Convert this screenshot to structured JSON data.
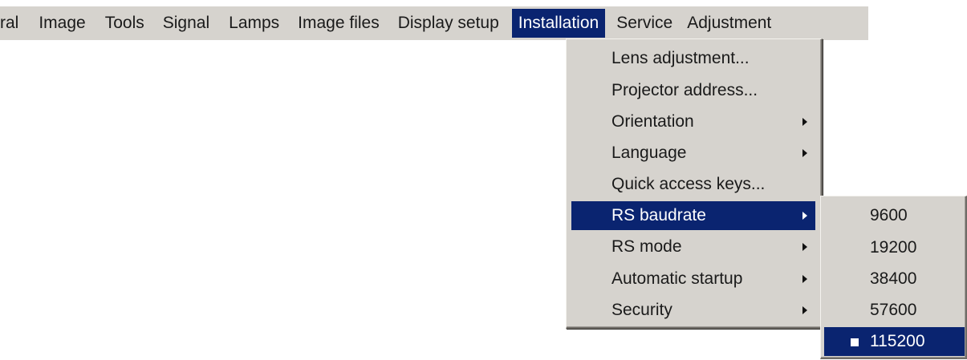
{
  "menubar": {
    "items": [
      {
        "label": "ral"
      },
      {
        "label": "Image"
      },
      {
        "label": "Tools"
      },
      {
        "label": "Signal"
      },
      {
        "label": "Lamps"
      },
      {
        "label": "Image files"
      },
      {
        "label": "Display setup"
      },
      {
        "label": "Installation"
      },
      {
        "label": "Service"
      },
      {
        "label": "Adjustment"
      }
    ],
    "active_index": 7
  },
  "installation_menu": {
    "items": [
      {
        "label": "Lens adjustment...",
        "has_submenu": false
      },
      {
        "label": "Projector address...",
        "has_submenu": false
      },
      {
        "label": "Orientation",
        "has_submenu": true
      },
      {
        "label": "Language",
        "has_submenu": true
      },
      {
        "label": "Quick access keys...",
        "has_submenu": false
      },
      {
        "label": "RS baudrate",
        "has_submenu": true
      },
      {
        "label": "RS mode",
        "has_submenu": true
      },
      {
        "label": "Automatic startup",
        "has_submenu": true
      },
      {
        "label": "Security",
        "has_submenu": true
      }
    ],
    "active_index": 5
  },
  "baudrate_submenu": {
    "items": [
      {
        "label": "9600"
      },
      {
        "label": "19200"
      },
      {
        "label": "38400"
      },
      {
        "label": "57600"
      },
      {
        "label": "115200"
      }
    ],
    "selected_index": 4
  },
  "colors": {
    "menu_background": "#d6d3ce",
    "highlight": "#0a2470",
    "highlight_text": "#ffffff"
  }
}
